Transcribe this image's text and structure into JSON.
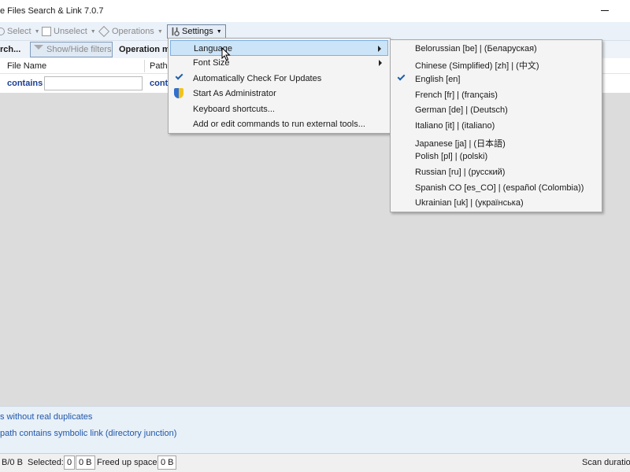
{
  "window": {
    "title": "e Files Search & Link 7.0.7"
  },
  "toolbar": {
    "select_label": "Select",
    "unselect_label": "Unselect",
    "operations_label": "Operations",
    "settings_label": "Settings"
  },
  "filterbar": {
    "search_label": "rch...",
    "show_hide_label": "Show/Hide filters",
    "operation_mode_label": "Operation m"
  },
  "columns": {
    "file_name": "File Name",
    "path": "Path"
  },
  "filter_row": {
    "contains_1": "contains",
    "contains_2": "cont"
  },
  "legend": {
    "line1": "s without real duplicates",
    "line2": "path contains symbolic link (directory junction)"
  },
  "status": {
    "size": "B/0 B",
    "selected_label": "Selected:",
    "selected_count": "0",
    "selected_size": "0 B",
    "freed_label": "Freed up space:",
    "freed_value": "0 B",
    "scan_label": "Scan duration"
  },
  "settings_menu": {
    "items": [
      {
        "label": "Language",
        "highlighted": true,
        "submenu": true
      },
      {
        "label": "Font Size",
        "submenu": true
      },
      {
        "label": "Automatically Check For Updates",
        "checked": true
      },
      {
        "label": "Start As Administrator",
        "icon": "shield-icon"
      },
      {
        "label": "Keyboard shortcuts..."
      },
      {
        "label": "Add or edit commands to run external tools..."
      }
    ]
  },
  "language_menu": {
    "items": [
      {
        "label": "Belorussian [be] | (Беларуская)"
      },
      {
        "label": "Chinese (Simplified) [zh] | (中文)"
      },
      {
        "label": "English [en]",
        "checked": true
      },
      {
        "label": "French [fr] | (français)"
      },
      {
        "label": "German [de] | (Deutsch)"
      },
      {
        "label": "Italiano [it] | (italiano)"
      },
      {
        "label": "Japanese [ja] | (日本語)"
      },
      {
        "label": "Polish [pl] | (polski)"
      },
      {
        "label": "Russian [ru] | (русский)"
      },
      {
        "label": "Spanish CO [es_CO] | (español (Colombia))"
      },
      {
        "label": "Ukrainian [uk] | (українська)"
      }
    ]
  },
  "colors": {
    "accent": "#1c3f94",
    "menu_highlight": "#cce4f7",
    "legend_text": "#1f57a8"
  }
}
